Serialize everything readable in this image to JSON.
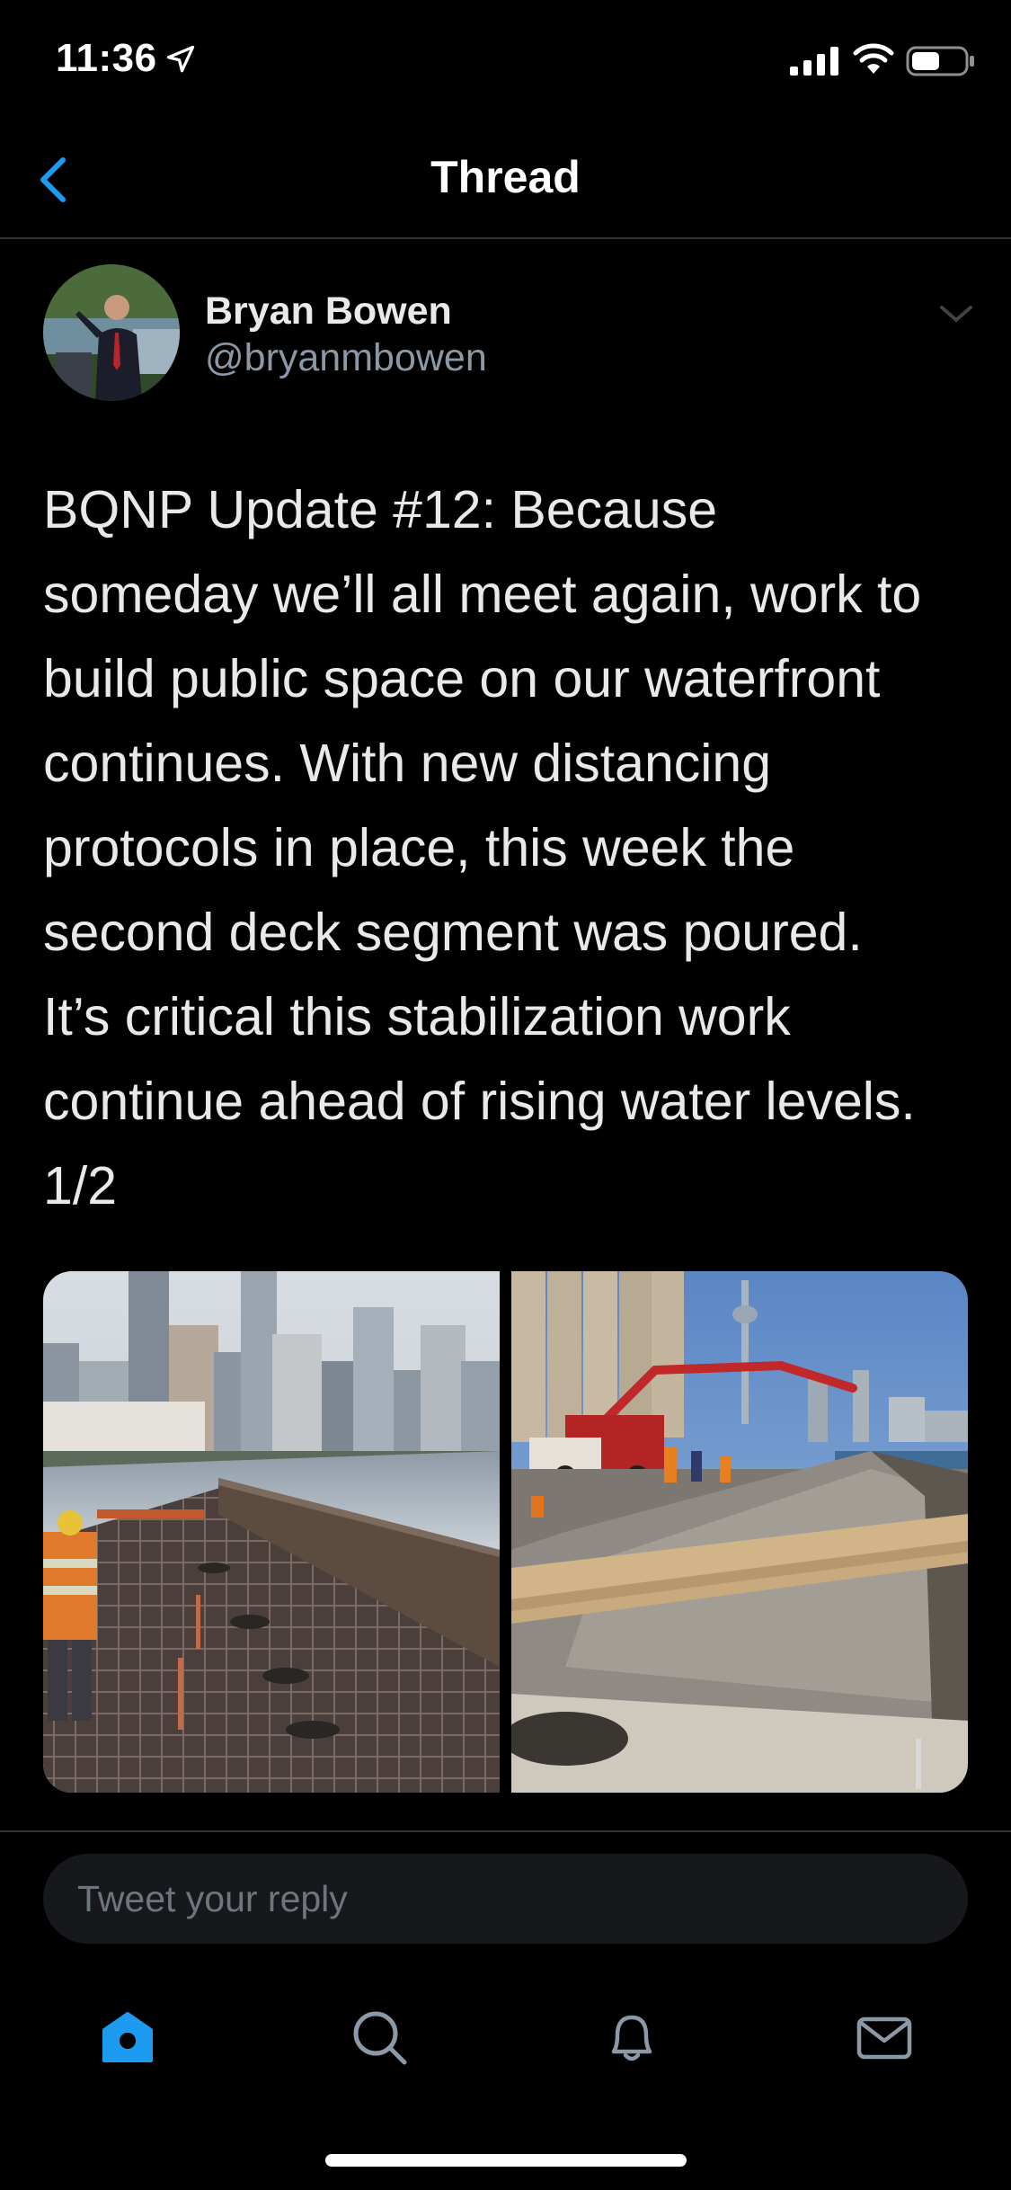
{
  "status_bar": {
    "time": "11:36"
  },
  "nav": {
    "title": "Thread"
  },
  "tweet": {
    "author_name": "Bryan Bowen",
    "author_handle": "@bryanmbowen",
    "text": "BQNP Update #12: Because\nsomeday we’ll all meet again, work to\nbuild public space on our waterfront\ncontinues. With new distancing\nprotocols in place, this week the\nsecond deck segment was poured.\nIt’s critical this stabilization work\ncontinue ahead of rising water levels.\n1/2",
    "media": [
      {
        "icon": "photo-rebar-deck"
      },
      {
        "icon": "photo-concrete-pour"
      }
    ]
  },
  "reply": {
    "placeholder": "Tweet your reply"
  },
  "tabs": [
    {
      "name": "home",
      "icon": "home-icon",
      "active": true
    },
    {
      "name": "search",
      "icon": "search-icon",
      "active": false
    },
    {
      "name": "notifications",
      "icon": "bell-icon",
      "active": false
    },
    {
      "name": "messages",
      "icon": "mail-icon",
      "active": false
    }
  ],
  "colors": {
    "background": "#000000",
    "accent": "#1d9bf0",
    "text_primary": "#e7e9ea",
    "text_secondary": "#8b98a5",
    "divider": "#2f3336"
  }
}
